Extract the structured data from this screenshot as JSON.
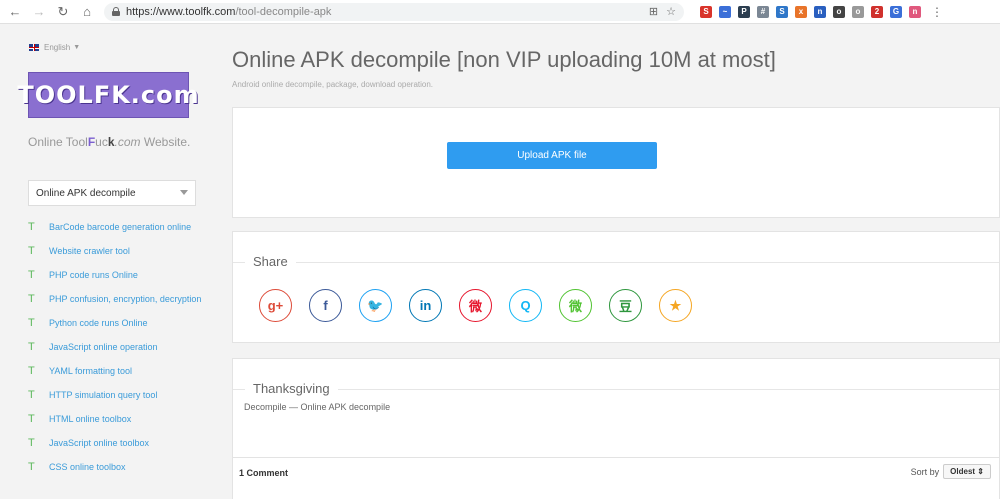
{
  "browser": {
    "url_host": "https://www.toolfk.com",
    "url_path": "/tool-decompile-apk",
    "extensions": [
      {
        "name": "S",
        "color": "#d9342b"
      },
      {
        "name": "~",
        "color": "#3b6fd8"
      },
      {
        "name": "P",
        "color": "#2c3e50"
      },
      {
        "name": "#",
        "color": "#7b8794"
      },
      {
        "name": "S",
        "color": "#2f77c9"
      },
      {
        "name": "x",
        "color": "#e8742a"
      },
      {
        "name": "n",
        "color": "#2a5fbf"
      },
      {
        "name": "o",
        "color": "#444"
      },
      {
        "name": "o",
        "color": "#999"
      },
      {
        "name": "2",
        "color": "#d0312d"
      },
      {
        "name": "G",
        "color": "#3b6fd8"
      },
      {
        "name": "n",
        "color": "#e0587d"
      }
    ]
  },
  "sidebar": {
    "language": "English",
    "logo_text": "TOOLFK.com",
    "slogan_pre": "Online Tool",
    "slogan_f": "F",
    "slogan_u": "u",
    "slogan_c": "c",
    "slogan_k": "k",
    "slogan_com": ".com",
    "slogan_post": " Website.",
    "select_value": "Online APK decompile",
    "tools": [
      "BarCode barcode generation online",
      "Website crawler tool",
      "PHP code runs Online",
      "PHP confusion, encryption, decryption",
      "Python code runs Online",
      "JavaScript online operation",
      "YAML formatting tool",
      "HTTP simulation query tool",
      "HTML online toolbox",
      "JavaScript online toolbox",
      "CSS online toolbox"
    ],
    "tool_marker": "T"
  },
  "main": {
    "title": "Online APK decompile [non VIP uploading 10M at most]",
    "subtitle": "Android online decompile, package, download operation.",
    "upload_label": "Upload APK file",
    "share_title": "Share",
    "share_icons": [
      {
        "name": "google-plus-icon",
        "glyph": "g+",
        "color": "#dd4b39"
      },
      {
        "name": "facebook-icon",
        "glyph": "f",
        "color": "#3b5998"
      },
      {
        "name": "twitter-icon",
        "glyph": "🐦",
        "color": "#1da1f2"
      },
      {
        "name": "linkedin-icon",
        "glyph": "in",
        "color": "#0077b5"
      },
      {
        "name": "weibo-icon",
        "glyph": "微",
        "color": "#e6162d"
      },
      {
        "name": "qq-icon",
        "glyph": "Q",
        "color": "#12b7f5"
      },
      {
        "name": "wechat-icon",
        "glyph": "微",
        "color": "#51c332"
      },
      {
        "name": "douban-icon",
        "glyph": "豆",
        "color": "#2e963d"
      },
      {
        "name": "qzone-icon",
        "glyph": "★",
        "color": "#f5a623"
      }
    ],
    "thanks_title": "Thanksgiving",
    "thanks_text": "Decompile — Online APK decompile",
    "comments_count": "1 Comment",
    "sort_label": "Sort by",
    "sort_value": "Oldest"
  }
}
